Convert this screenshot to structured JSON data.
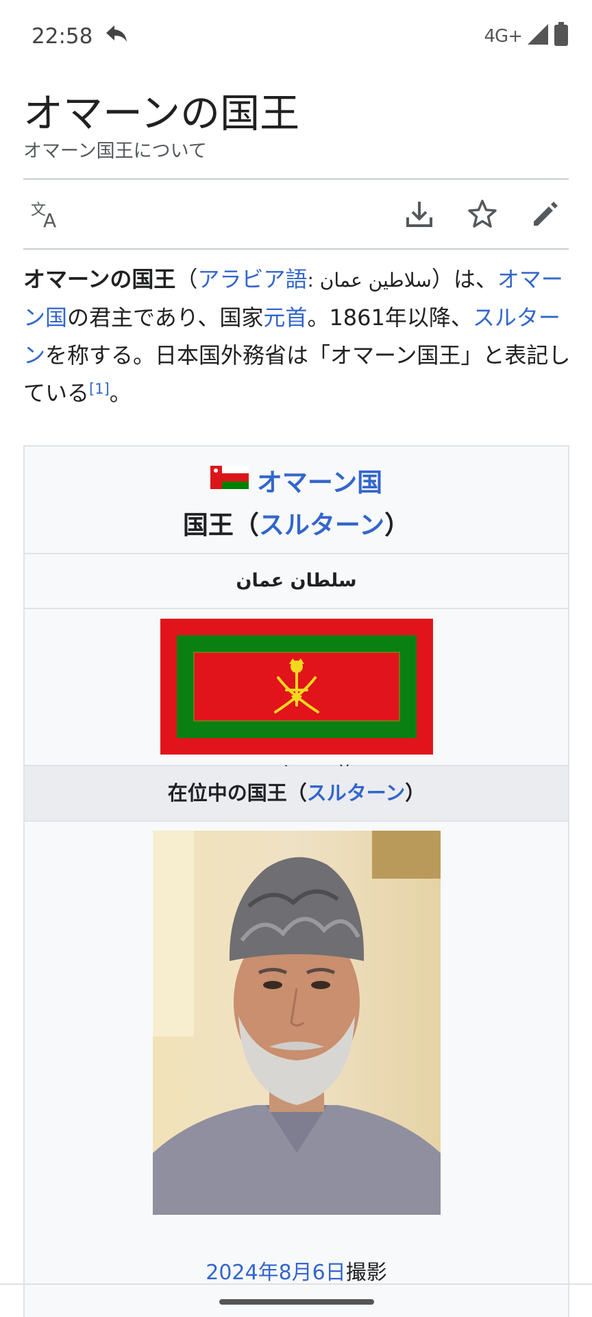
{
  "status_bar": {
    "time": "22:58",
    "network": "4G+",
    "icons": [
      "reply-arrow-icon",
      "signal-icon",
      "battery-icon"
    ]
  },
  "article": {
    "title": "オマーンの国王",
    "subtitle": "オマーン国王について"
  },
  "toolbar": {
    "icons": [
      "translate-icon",
      "download-icon",
      "star-icon",
      "edit-icon"
    ]
  },
  "lead": {
    "bold_title": "オマーンの国王",
    "paren_open": "（",
    "arabic_link": "アラビア語",
    "arabic_text": ": سلاطين عمان",
    "paren_close": "）は、",
    "oman_link": "オマーン国",
    "t1": "の君主であり、国家",
    "head_link": "元首",
    "t2": "。1861年以降、",
    "sultan_link": "スルターン",
    "t3": "を称する。日本国外務省は「オマーン国王」と表記している",
    "ref": "[1]",
    "t4": "。"
  },
  "infobox": {
    "country_link": "オマーン国",
    "heading_prefix": "国王（",
    "heading_link": "スルターン",
    "heading_suffix": "）",
    "arabic_name": "سلطان عمان",
    "flag_caption": "スルターン旗",
    "section_prefix": "在位中の国王（",
    "section_link": "スルターン",
    "section_suffix": "）",
    "photo_date_link": "2024年8月6日",
    "photo_caption_suffix": "撮影"
  },
  "colors": {
    "link": "#3366cc",
    "flag_red": "#e1141b",
    "flag_green": "#0a8012",
    "emblem_yellow": "#f5d81f"
  }
}
